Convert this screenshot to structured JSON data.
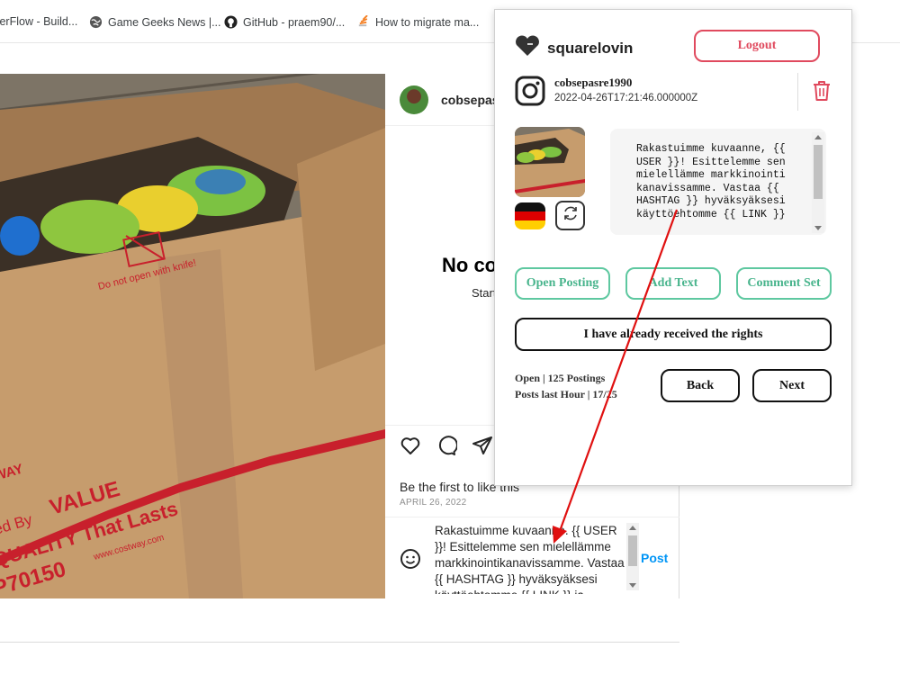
{
  "bookmarks": [
    {
      "label": "terFlow - Build...",
      "icon": "tab-favicon",
      "color": "#f59e0b"
    },
    {
      "label": "Game Geeks News |...",
      "icon": "globe-icon",
      "color": "#555555"
    },
    {
      "label": "GitHub - praem90/...",
      "icon": "github-icon",
      "color": "#222222"
    },
    {
      "label": "How to migrate ma...",
      "icon": "stack-overflow-icon",
      "color": "#f48024"
    }
  ],
  "instagram": {
    "username": "cobsepas",
    "no_comments_title": "No co",
    "no_comments_sub": "Start",
    "likes_text": "Be the first to like this",
    "date": "APRIL 26, 2022",
    "comment_text": "Rakastuimme kuvaanne. {{ USER }}! Esittelemme sen mielellämme markkinointikanavissamme. Vastaa {{ HASHTAG }} hyväksyäksesi käyttöehtomme {{ LINK }} ja",
    "post_label": "Post",
    "photo_text": {
      "warning": "Do not open with knife!",
      "brand": "WAY",
      "value": "VALUE",
      "quality": "QUALITY That Lasts",
      "by": "ed By",
      "site": "www.costway.com",
      "code": "P70150"
    }
  },
  "popup": {
    "brand": "squarelovin",
    "logout_label": "Logout",
    "account_name": "cobsepasre1990",
    "account_date": "2022-04-26T17:21:46.000000Z",
    "caption": "Rakastuimme kuvaanne, {{ USER }}! Esittelemme sen mielellämme markkinointikanavissamme. Vastaa {{ HASHTAG }} hyväksyäksesi käyttöehtomme {{ LINK }}",
    "buttons": {
      "open_posting": "Open Posting",
      "add_text": "Add Text",
      "comment_set": "Comment Set",
      "rights": "I have already received the rights",
      "back": "Back",
      "next": "Next"
    },
    "stats_open": "Open | 125 Postings",
    "stats_hour": "Posts last Hour | 17/25"
  },
  "colors": {
    "accent_red": "#e04a5e",
    "accent_green": "#48b48c",
    "ig_blue": "#0095f6",
    "annotation_arrow": "#e01010"
  }
}
